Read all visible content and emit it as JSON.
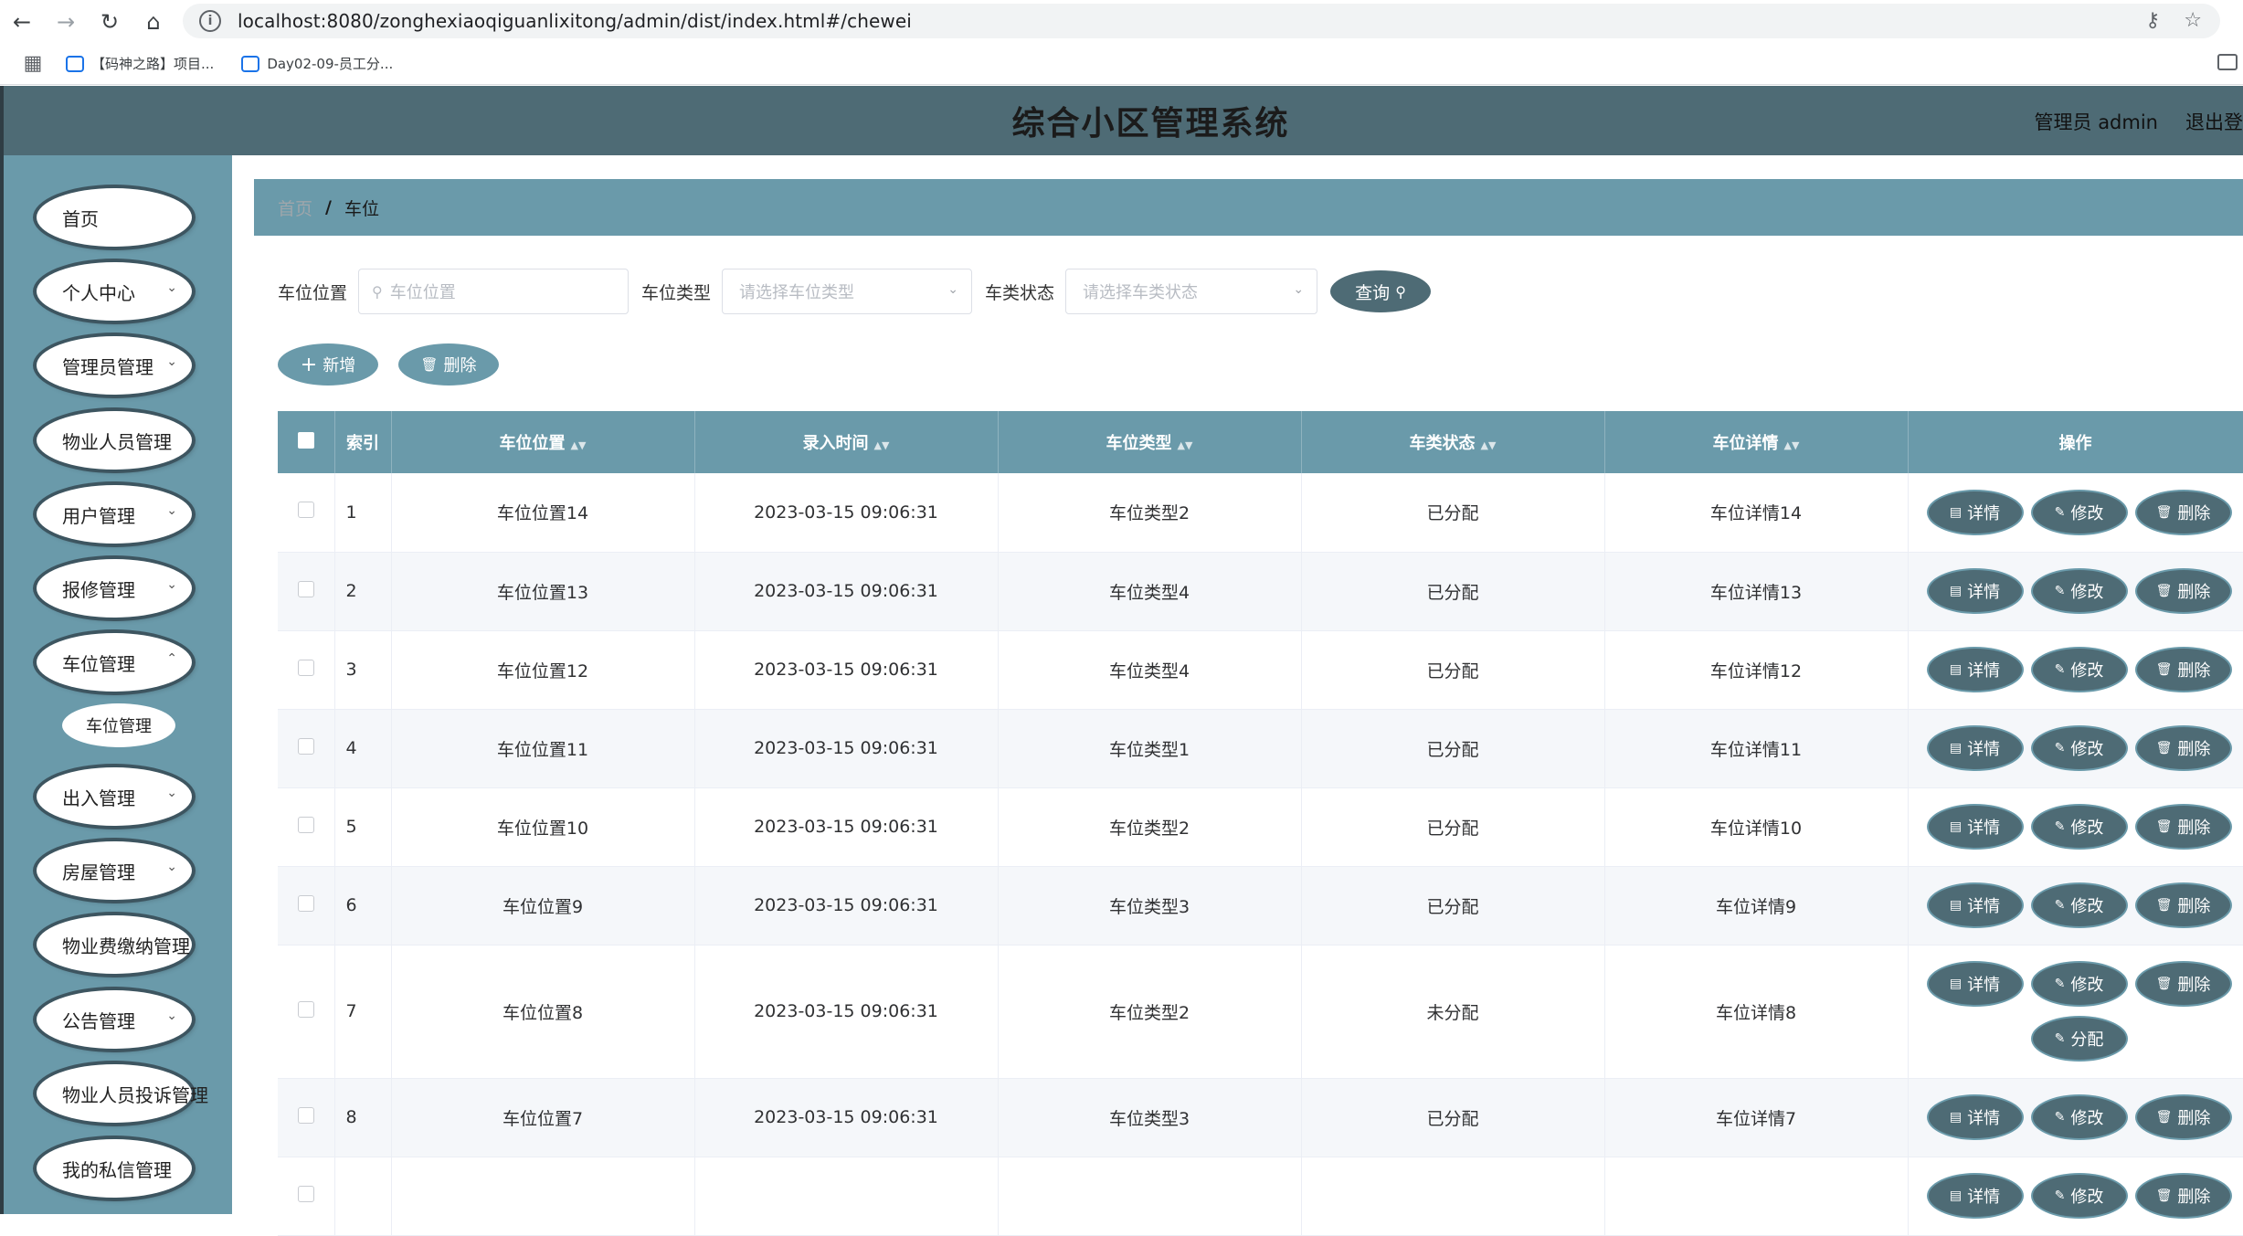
{
  "browser": {
    "url": "localhost:8080/zonghexiaoqiguanlixitong/admin/dist/index.html#/chewei",
    "bookmarks": [
      "【码神之路】项目...",
      "Day02-09-员工分..."
    ]
  },
  "header": {
    "title": "综合小区管理系统",
    "user_label": "管理员 admin",
    "logout_label": "退出登"
  },
  "sidebar": {
    "items": [
      {
        "label": "首页",
        "has_arrow": false
      },
      {
        "label": "个人中心",
        "has_arrow": true
      },
      {
        "label": "管理员管理",
        "has_arrow": true
      },
      {
        "label": "物业人员管理",
        "has_arrow": false
      },
      {
        "label": "用户管理",
        "has_arrow": true
      },
      {
        "label": "报修管理",
        "has_arrow": true
      },
      {
        "label": "车位管理",
        "has_arrow": true
      },
      {
        "label": "出入管理",
        "has_arrow": true
      },
      {
        "label": "房屋管理",
        "has_arrow": true
      },
      {
        "label": "物业费缴纳管理",
        "has_arrow": false
      },
      {
        "label": "公告管理",
        "has_arrow": true
      },
      {
        "label": "物业人员投诉管理",
        "has_arrow": false
      },
      {
        "label": "我的私信管理",
        "has_arrow": false
      }
    ],
    "sub_item": "车位管理"
  },
  "breadcrumb": {
    "home": "首页",
    "separator": "/",
    "current": "车位"
  },
  "filters": {
    "location_label": "车位位置",
    "location_placeholder": "车位位置",
    "type_label": "车位类型",
    "type_placeholder": "请选择车位类型",
    "status_label": "车类状态",
    "status_placeholder": "请选择车类状态",
    "query_label": "查询"
  },
  "actions": {
    "add_label": "新增",
    "delete_label": "删除"
  },
  "table": {
    "headers": [
      "索引",
      "车位位置",
      "录入时间",
      "车位类型",
      "车类状态",
      "车位详情",
      "操作"
    ],
    "rows": [
      {
        "index": "1",
        "location": "车位位置14",
        "time": "2023-03-15 09:06:31",
        "type": "车位类型2",
        "status": "已分配",
        "detail": "车位详情14"
      },
      {
        "index": "2",
        "location": "车位位置13",
        "time": "2023-03-15 09:06:31",
        "type": "车位类型4",
        "status": "已分配",
        "detail": "车位详情13"
      },
      {
        "index": "3",
        "location": "车位位置12",
        "time": "2023-03-15 09:06:31",
        "type": "车位类型4",
        "status": "已分配",
        "detail": "车位详情12"
      },
      {
        "index": "4",
        "location": "车位位置11",
        "time": "2023-03-15 09:06:31",
        "type": "车位类型1",
        "status": "已分配",
        "detail": "车位详情11"
      },
      {
        "index": "5",
        "location": "车位位置10",
        "time": "2023-03-15 09:06:31",
        "type": "车位类型2",
        "status": "已分配",
        "detail": "车位详情10"
      },
      {
        "index": "6",
        "location": "车位位置9",
        "time": "2023-03-15 09:06:31",
        "type": "车位类型3",
        "status": "已分配",
        "detail": "车位详情9"
      },
      {
        "index": "7",
        "location": "车位位置8",
        "time": "2023-03-15 09:06:31",
        "type": "车位类型2",
        "status": "未分配",
        "detail": "车位详情8"
      },
      {
        "index": "8",
        "location": "车位位置7",
        "time": "2023-03-15 09:06:31",
        "type": "车位类型3",
        "status": "已分配",
        "detail": "车位详情7"
      },
      {
        "index": "",
        "location": "",
        "time": "",
        "type": "",
        "status": "",
        "detail": ""
      }
    ],
    "op_labels": {
      "detail": "详情",
      "edit": "修改",
      "delete": "删除",
      "assign": "分配"
    }
  },
  "colors": {
    "header_bg": "#4e6b75",
    "sidebar_bg": "#6a9aaa",
    "button_dark": "#4e6b75"
  }
}
